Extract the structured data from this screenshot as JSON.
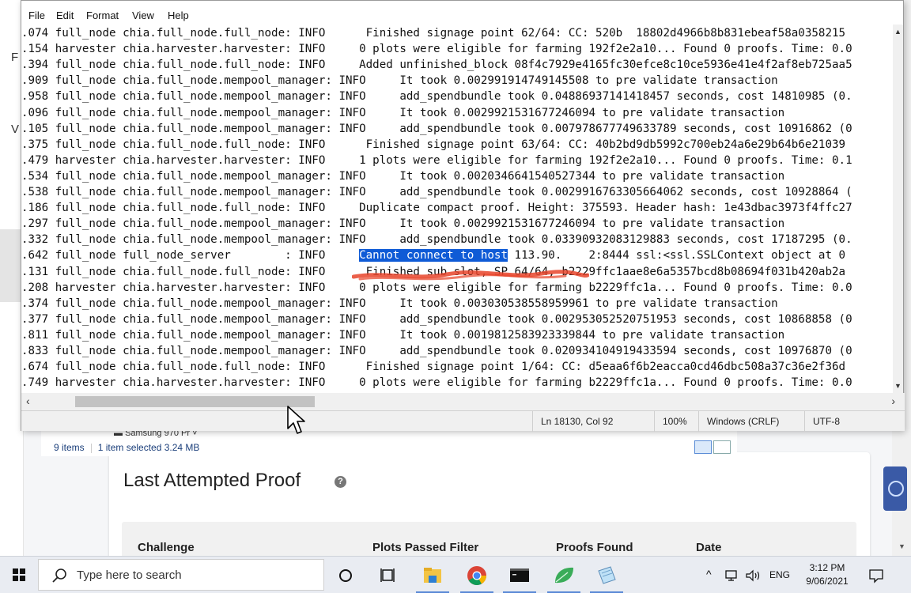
{
  "background_app": {
    "left_letters": [
      "F",
      "V"
    ],
    "card": {
      "title": "Last Attempted Proof",
      "help_icon": "?",
      "columns": [
        "Challenge",
        "Plots Passed Filter",
        "Proofs Found",
        "Date"
      ]
    },
    "badge_color": "#3a5aa6"
  },
  "explorer": {
    "drive_label": "Samsung 970 Pr",
    "items_count": "9 items",
    "selection": "1 item selected  3.24 MB"
  },
  "notepad": {
    "menu": [
      "File",
      "Edit",
      "Format",
      "View",
      "Help"
    ],
    "lines": [
      ".074 full_node chia.full_node.full_node: INFO      Finished signage point 62/64: CC: 520b  18802d4966b8b831ebeaf58a0358215",
      ".154 harvester chia.harvester.harvester: INFO     0 plots were eligible for farming 192f2e2a10... Found 0 proofs. Time: 0.0",
      ".394 full_node chia.full_node.full_node: INFO     Added unfinished_block 08f4c7929e4165fc30efce8c10ce5936e41e4f2af8eb725aa5",
      ".909 full_node chia.full_node.mempool_manager: INFO     It took 0.002991914749145508 to pre validate transaction",
      ".958 full_node chia.full_node.mempool_manager: INFO     add_spendbundle took 0.04886937141418457 seconds, cost 14810985 (0.",
      ".096 full_node chia.full_node.mempool_manager: INFO     It took 0.0029921531677246094 to pre validate transaction",
      ".105 full_node chia.full_node.mempool_manager: INFO     add_spendbundle took 0.007978677749633789 seconds, cost 10916862 (0",
      ".375 full_node chia.full_node.full_node: INFO      Finished signage point 63/64: CC: 40b2bd9db5992c700eb24a6e29b64b6e21039",
      ".479 harvester chia.harvester.harvester: INFO     1 plots were eligible for farming 192f2e2a10... Found 0 proofs. Time: 0.1",
      ".534 full_node chia.full_node.mempool_manager: INFO     It took 0.0020346641540527344 to pre validate transaction",
      ".538 full_node chia.full_node.mempool_manager: INFO     add_spendbundle took 0.0029916763305664062 seconds, cost 10928864 (",
      ".186 full_node chia.full_node.full_node: INFO     Duplicate compact proof. Height: 375593. Header hash: 1e43dbac3973f4ffc27",
      ".297 full_node chia.full_node.mempool_manager: INFO     It took 0.0029921531677246094 to pre validate transaction",
      ".332 full_node chia.full_node.mempool_manager: INFO     add_spendbundle took 0.03390932083129883 seconds, cost 17187295 (0.",
      ".642 full_node full_node_server        : INFO     |Cannot connect to host| 113.90.    2:8444 ssl:<ssl.SSLContext object at 0",
      ".131 full_node chia.full_node.full_node: INFO      Finished sub slot, SP 64/64, b2229ffc1aae8e6a5357bcd8b08694f031b420ab2a",
      ".208 harvester chia.harvester.harvester: INFO     0 plots were eligible for farming b2229ffc1a... Found 0 proofs. Time: 0.0",
      ".374 full_node chia.full_node.mempool_manager: INFO     It took 0.003030538558959961 to pre validate transaction",
      ".377 full_node chia.full_node.mempool_manager: INFO     add_spendbundle took 0.002953052520751953 seconds, cost 10868858 (0",
      ".811 full_node chia.full_node.mempool_manager: INFO     It took 0.0019812583923339844 to pre validate transaction",
      ".833 full_node chia.full_node.mempool_manager: INFO     add_spendbundle took 0.020934104919433594 seconds, cost 10976870 (0",
      ".674 full_node chia.full_node.full_node: INFO      Finished signage point 1/64: CC: d5eaa6f6b2eacca0cd46dbc508a37c36e2f36d",
      ".749 harvester chia.harvester.harvester: INFO     0 plots were eligible for farming b2229ffc1a... Found 0 proofs. Time: 0.0"
    ],
    "highlight_color": "#0f5bd6",
    "scribble_color": "#e8442a",
    "status": {
      "position": "Ln 18130, Col 92",
      "zoom": "100%",
      "line_ending": "Windows (CRLF)",
      "encoding": "UTF-8"
    },
    "hscroll_thumb_fraction": 0.27
  },
  "taskbar": {
    "search_placeholder": "Type here to search",
    "tray_lang": "ENG",
    "time": "3:12 PM",
    "date": "9/06/2021",
    "accent": "#5a89d6"
  }
}
